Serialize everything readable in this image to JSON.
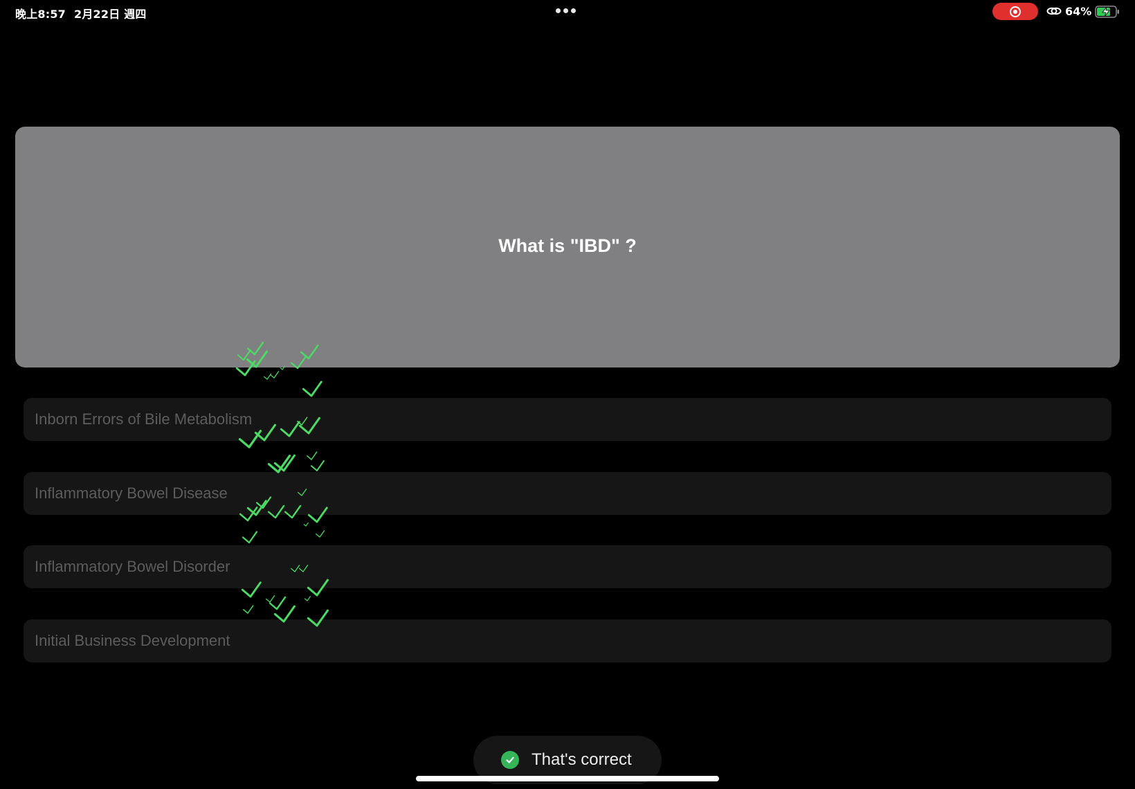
{
  "status_bar": {
    "time": "晚上8:57",
    "date": "2月22日 週四",
    "battery_percent": "64%",
    "icons": [
      "multitasking-dots-icon",
      "screen-record-icon",
      "link-icon",
      "battery-charging-icon"
    ],
    "record_color": "#e0302e",
    "battery_color": "#34c759"
  },
  "question": {
    "text": "What is \"IBD\" ?",
    "card_color": "#807f82"
  },
  "options": [
    {
      "label": "Inborn Errors of Bile Metabolism"
    },
    {
      "label": "Inflammatory Bowel Disease"
    },
    {
      "label": "Inflammatory Bowel Disorder"
    },
    {
      "label": "Initial Business Development"
    }
  ],
  "toast": {
    "text": "That's correct",
    "icon": "check-circle-icon",
    "accent": "#35b558"
  },
  "confetti": {
    "icon": "checkmark-icon",
    "color": "#4cd964"
  }
}
